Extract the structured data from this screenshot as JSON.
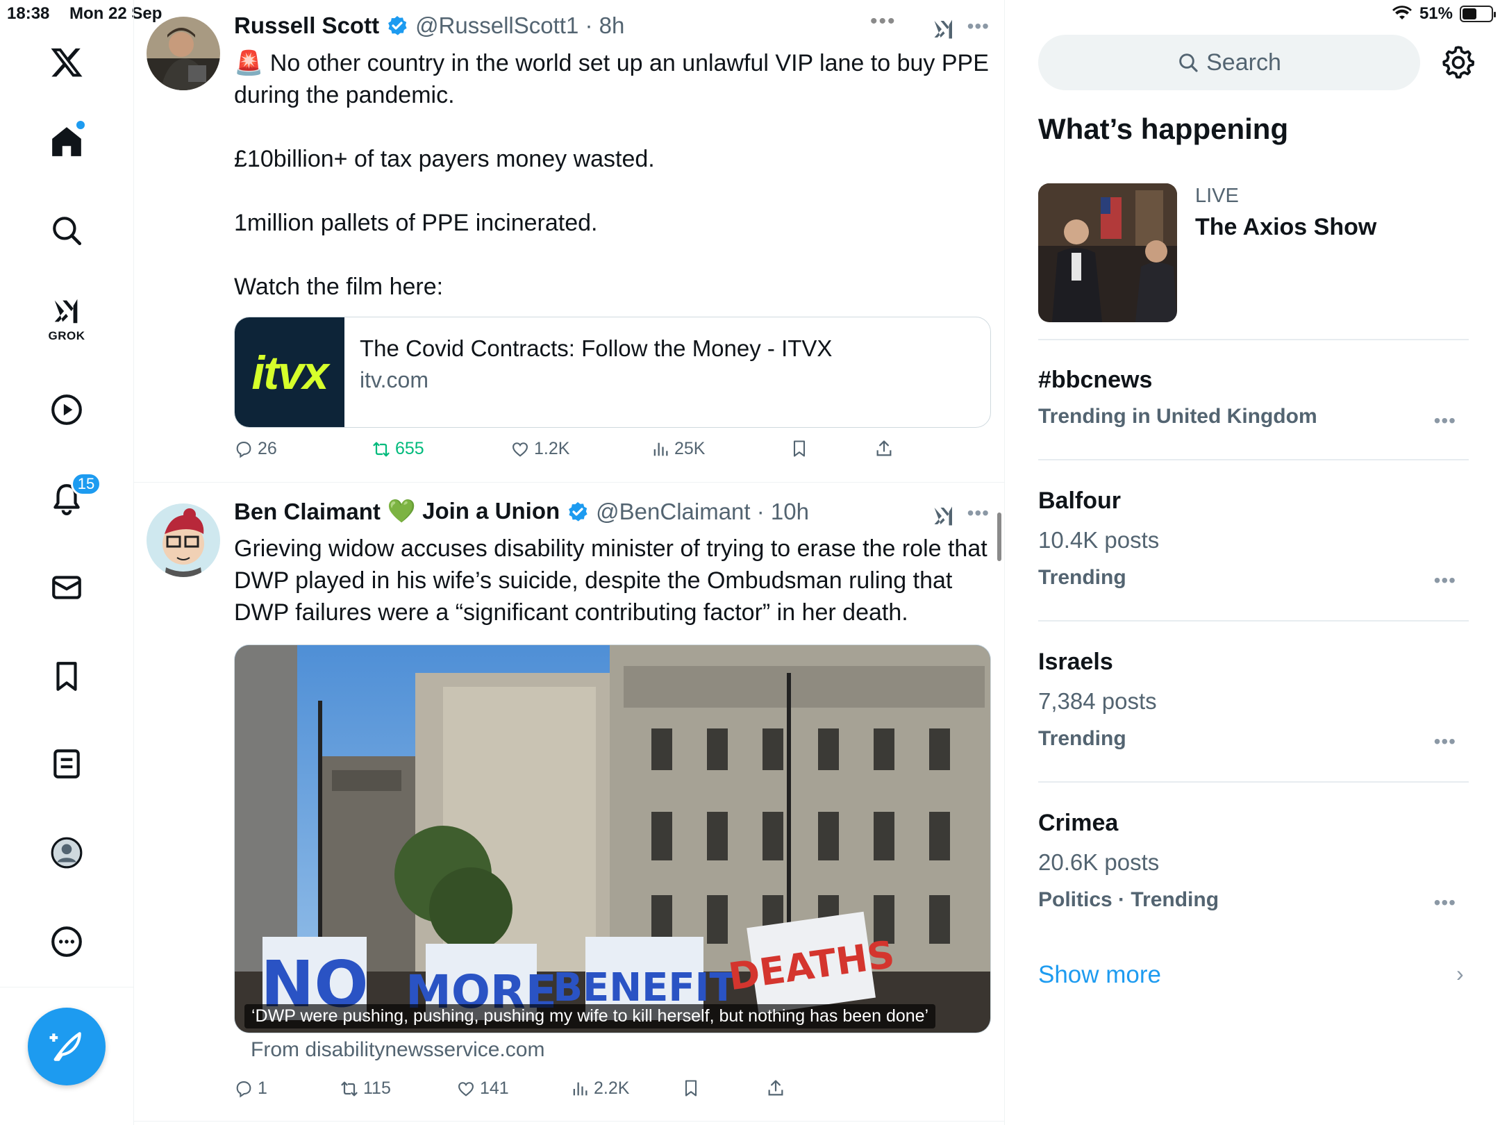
{
  "status_bar": {
    "time": "18:38",
    "date": "Mon 22 Sep",
    "battery": "51%",
    "battery_level": 0.51
  },
  "nav": {
    "grok_label": "GROK",
    "notifications_count": "15",
    "items": [
      "x-logo",
      "home-icon",
      "search-icon",
      "grok-icon",
      "video-icon",
      "bell-icon",
      "mail-icon",
      "bookmark-icon",
      "list-icon",
      "profile-icon",
      "more-icon"
    ]
  },
  "feed": {
    "tweets": [
      {
        "name": "Russell Scott",
        "handle": "@RussellScott1",
        "time": "8h",
        "text": [
          "🚨 No other country in the world set up an unlawful VIP lane to buy PPE during the pandemic.",
          "£10billion+ of tax payers money wasted.",
          "1million pallets of PPE incinerated.",
          "Watch the film here:"
        ],
        "card": {
          "thumb": "itvx",
          "title": "The Covid Contracts: Follow the Money - ITVX",
          "domain": "itv.com"
        },
        "replies": "26",
        "reposts": "655",
        "likes": "1.2K",
        "views": "25K"
      },
      {
        "name": "Ben Claimant",
        "name_suffix": "💚 Join a Union",
        "handle": "@BenClaimant",
        "time": "10h",
        "text": "Grieving widow accuses disability minister of trying to erase the role that DWP played in his wife’s suicide, despite the Ombudsman ruling that DWP failures were a “significant contributing factor” in her death.",
        "media_caption": "‘DWP were pushing, pushing, pushing my wife to kill herself, but nothing has been done’",
        "placard_words": [
          "NO",
          "MORE",
          "BENEFIT",
          "DEATHS"
        ],
        "source": "From disabilitynewsservice.com",
        "replies": "1",
        "reposts": "115",
        "likes": "141",
        "views": "2.2K"
      }
    ]
  },
  "sidebar": {
    "search_placeholder": "Search",
    "section_title": "What’s happening",
    "live": {
      "label": "LIVE",
      "title": "The Axios Show"
    },
    "trends": [
      {
        "name": "#bbcnews",
        "posts": "",
        "meta": "Trending in United Kingdom"
      },
      {
        "name": "Balfour",
        "posts": "10.4K posts",
        "meta": "Trending"
      },
      {
        "name": "Israels",
        "posts": "7,384 posts",
        "meta": "Trending"
      },
      {
        "name": "Crimea",
        "posts": "20.6K posts",
        "meta": "Politics · Trending"
      }
    ],
    "show_more": "Show more"
  },
  "colors": {
    "accent": "#1d9bf0",
    "repost_green": "#00ba7c",
    "muted": "#536471",
    "itvx_bg": "#0d2438",
    "itvx_text": "#d6ff2b"
  }
}
